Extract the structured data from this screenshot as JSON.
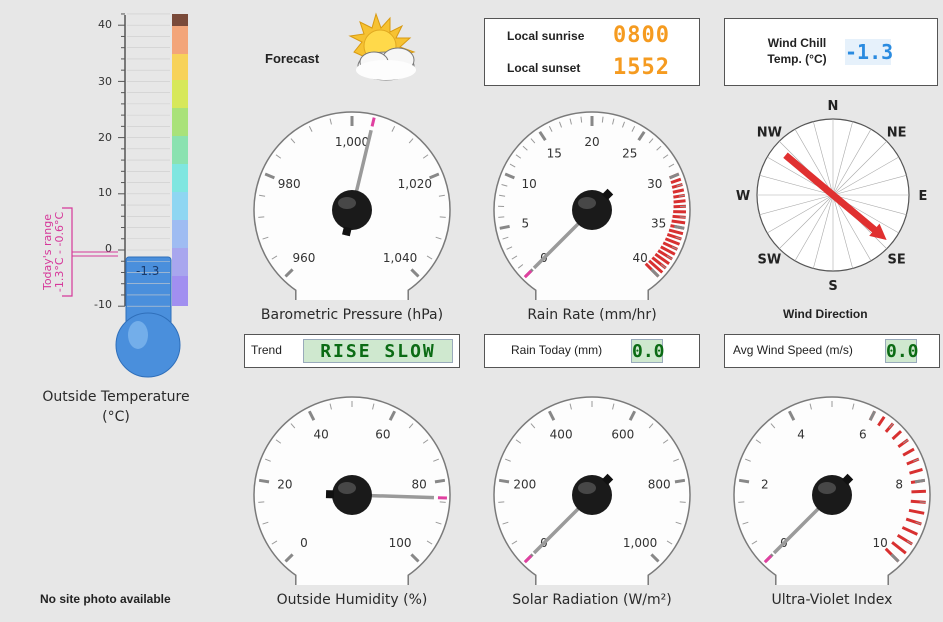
{
  "thermometer": {
    "label_line1": "Outside Temperature",
    "label_line2": "(°C)",
    "scale_ticks": [
      "40",
      "30",
      "20",
      "10",
      "0",
      "-10"
    ],
    "current_value": -1.3,
    "current_text": "-1.3",
    "range_line1": "Today's range",
    "range_line2": "-1.3°C - -0.6°C",
    "range_min": -1.3,
    "range_max": -0.6,
    "mercury_color": "#3d86d8",
    "range_color": "#d6389a"
  },
  "no_photo": "No site photo available",
  "forecast": {
    "label": "Forecast",
    "icon": "partly-cloudy-sun-icon"
  },
  "sun": {
    "sunrise_label": "Local sunrise",
    "sunrise_value": "0800",
    "sunset_label": "Local sunset",
    "sunset_value": "1552"
  },
  "wind_chill": {
    "label_line1": "Wind Chill",
    "label_line2": "Temp. (°C)",
    "value": "-1.3"
  },
  "gauges": {
    "pressure": {
      "title": "Barometric Pressure (hPa)",
      "ticks": [
        "960",
        "980",
        "1,000",
        "1,020",
        "1,040"
      ],
      "value": 1004
    },
    "rain_rate": {
      "title": "Rain Rate (mm/hr)",
      "ticks": [
        "0",
        "5",
        "10",
        "15",
        "20",
        "25",
        "30",
        "35",
        "40"
      ],
      "value": 0
    },
    "humidity": {
      "title": "Outside Humidity (%)",
      "ticks": [
        "0",
        "20",
        "40",
        "60",
        "80",
        "100"
      ],
      "value": 84
    },
    "solar": {
      "title": "Solar Radiation (W/m²)",
      "ticks": [
        "0",
        "200",
        "400",
        "600",
        "800",
        "1,000"
      ],
      "value": 0
    },
    "uv": {
      "title": "Ultra-Violet Index",
      "ticks": [
        "0",
        "2",
        "4",
        "6",
        "8",
        "10"
      ],
      "value": 0
    }
  },
  "wind": {
    "title": "Wind Direction",
    "compass": [
      "N",
      "NE",
      "E",
      "SE",
      "S",
      "SW",
      "W",
      "NW"
    ],
    "direction_deg": 130,
    "arrow_color": "#e03030"
  },
  "trend": {
    "label": "Trend",
    "value": "RISE SLOW"
  },
  "rain_today": {
    "label": "Rain Today (mm)",
    "value": "0.0"
  },
  "avg_wind": {
    "label": "Avg Wind Speed (m/s)",
    "value": "0.0"
  }
}
